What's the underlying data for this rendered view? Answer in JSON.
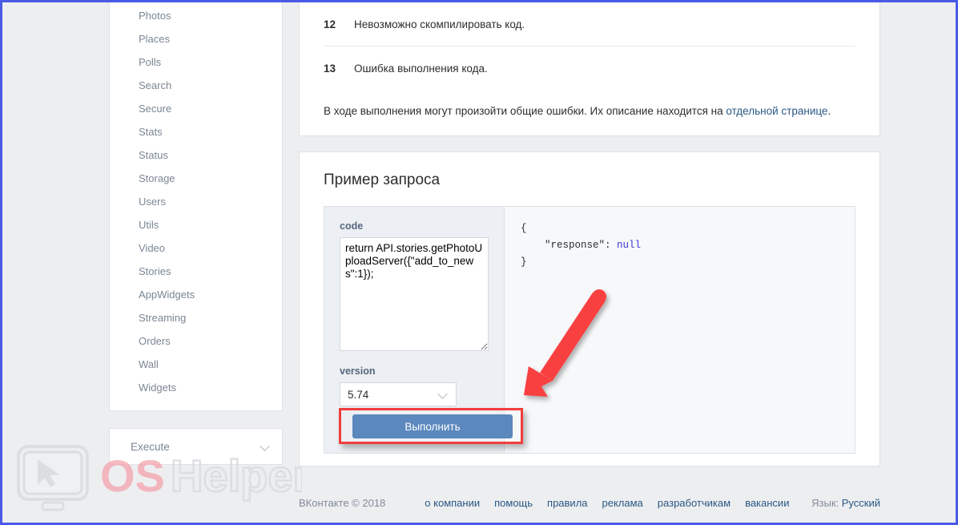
{
  "sidebar": {
    "items": [
      {
        "label": "Photos"
      },
      {
        "label": "Places"
      },
      {
        "label": "Polls"
      },
      {
        "label": "Search"
      },
      {
        "label": "Secure"
      },
      {
        "label": "Stats"
      },
      {
        "label": "Status"
      },
      {
        "label": "Storage"
      },
      {
        "label": "Users"
      },
      {
        "label": "Utils"
      },
      {
        "label": "Video"
      },
      {
        "label": "Stories"
      },
      {
        "label": "AppWidgets"
      },
      {
        "label": "Streaming"
      },
      {
        "label": "Orders"
      },
      {
        "label": "Wall"
      },
      {
        "label": "Widgets"
      }
    ],
    "execute_dropdown": {
      "label": "Execute",
      "icon": "chevron-down-icon"
    }
  },
  "errors_table": {
    "rows": [
      {
        "code": "12",
        "description": "Невозможно скомпилировать код."
      },
      {
        "code": "13",
        "description": "Ошибка выполнения кода."
      }
    ],
    "note_before_link": "В ходе выполнения могут произойти общие ошибки. Их описание находится на ",
    "note_link": "отдельной странице",
    "note_after_link": "."
  },
  "example": {
    "title": "Пример запроса",
    "code_label": "code",
    "code_value": "return API.stories.getPhotoUploadServer({\"add_to_news\":1});",
    "version_label": "version",
    "version_value": "5.74",
    "version_icon": "chevron-down-icon",
    "submit_label": "Выполнить",
    "response_line1": "{",
    "response_key": "    \"response\": ",
    "response_null": "null",
    "response_line3": "}"
  },
  "annotations": {
    "arrow_color": "#f94040",
    "highlight_color": "#f23d3d"
  },
  "footer": {
    "copyright": "ВКонтакте © 2018",
    "links": [
      {
        "label": "о компании"
      },
      {
        "label": "помощь"
      },
      {
        "label": "правила"
      },
      {
        "label": "реклама"
      },
      {
        "label": "разработчикам"
      },
      {
        "label": "вакансии"
      }
    ],
    "lang_label": "Язык: ",
    "lang_value": "Русский"
  },
  "watermark": {
    "text_os": "OS",
    "text_helper": "Helper",
    "icon": "monitor-cursor-icon"
  },
  "colors": {
    "accent_blue": "#5b88bd",
    "link_blue": "#2a5885",
    "page_bg": "#edeef0",
    "panel_bg": "#eceff3"
  }
}
